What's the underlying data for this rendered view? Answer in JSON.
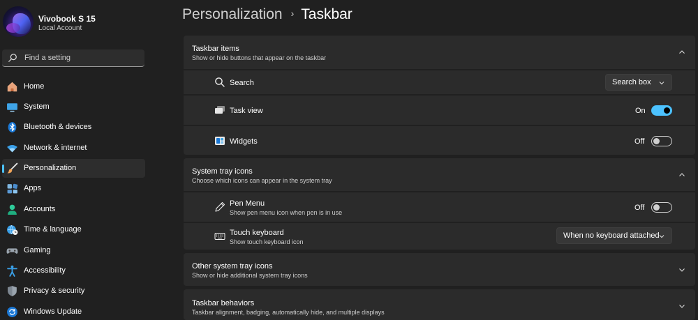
{
  "profile": {
    "name": "Vivobook S 15",
    "account": "Local Account"
  },
  "search": {
    "placeholder": "Find a setting"
  },
  "sidebar": {
    "items": [
      {
        "label": "Home",
        "icon": "home-icon",
        "active": false
      },
      {
        "label": "System",
        "icon": "monitor-icon",
        "active": false
      },
      {
        "label": "Bluetooth & devices",
        "icon": "bluetooth-icon",
        "active": false
      },
      {
        "label": "Network & internet",
        "icon": "wifi-icon",
        "active": false
      },
      {
        "label": "Personalization",
        "icon": "brush-icon",
        "active": true
      },
      {
        "label": "Apps",
        "icon": "apps-icon",
        "active": false
      },
      {
        "label": "Accounts",
        "icon": "person-icon",
        "active": false
      },
      {
        "label": "Time & language",
        "icon": "globe-clock-icon",
        "active": false
      },
      {
        "label": "Gaming",
        "icon": "gamepad-icon",
        "active": false
      },
      {
        "label": "Accessibility",
        "icon": "accessibility-icon",
        "active": false
      },
      {
        "label": "Privacy & security",
        "icon": "shield-icon",
        "active": false
      },
      {
        "label": "Windows Update",
        "icon": "update-icon",
        "active": false
      }
    ]
  },
  "breadcrumb": {
    "parent": "Personalization",
    "separator": "›",
    "current": "Taskbar"
  },
  "taskbar_items": {
    "title": "Taskbar items",
    "subtitle": "Show or hide buttons that appear on the taskbar",
    "expanded": true,
    "rows": {
      "search": {
        "label": "Search",
        "value": "Search box"
      },
      "task_view": {
        "label": "Task view",
        "state_text": "On",
        "state": true
      },
      "widgets": {
        "label": "Widgets",
        "state_text": "Off",
        "state": false
      }
    }
  },
  "system_tray": {
    "title": "System tray icons",
    "subtitle": "Choose which icons can appear in the system tray",
    "expanded": true,
    "rows": {
      "pen_menu": {
        "label": "Pen Menu",
        "sub": "Show pen menu icon when pen is in use",
        "state_text": "Off",
        "state": false
      },
      "touch_keyboard": {
        "label": "Touch keyboard",
        "sub": "Show touch keyboard icon",
        "value": "When no keyboard attached"
      }
    }
  },
  "other_tray": {
    "title": "Other system tray icons",
    "subtitle": "Show or hide additional system tray icons",
    "expanded": false
  },
  "behaviors": {
    "title": "Taskbar behaviors",
    "subtitle": "Taskbar alignment, badging, automatically hide, and multiple displays",
    "expanded": false
  },
  "colors": {
    "accent": "#4cc2ff",
    "background": "#202020",
    "card": "#2b2b2b"
  }
}
